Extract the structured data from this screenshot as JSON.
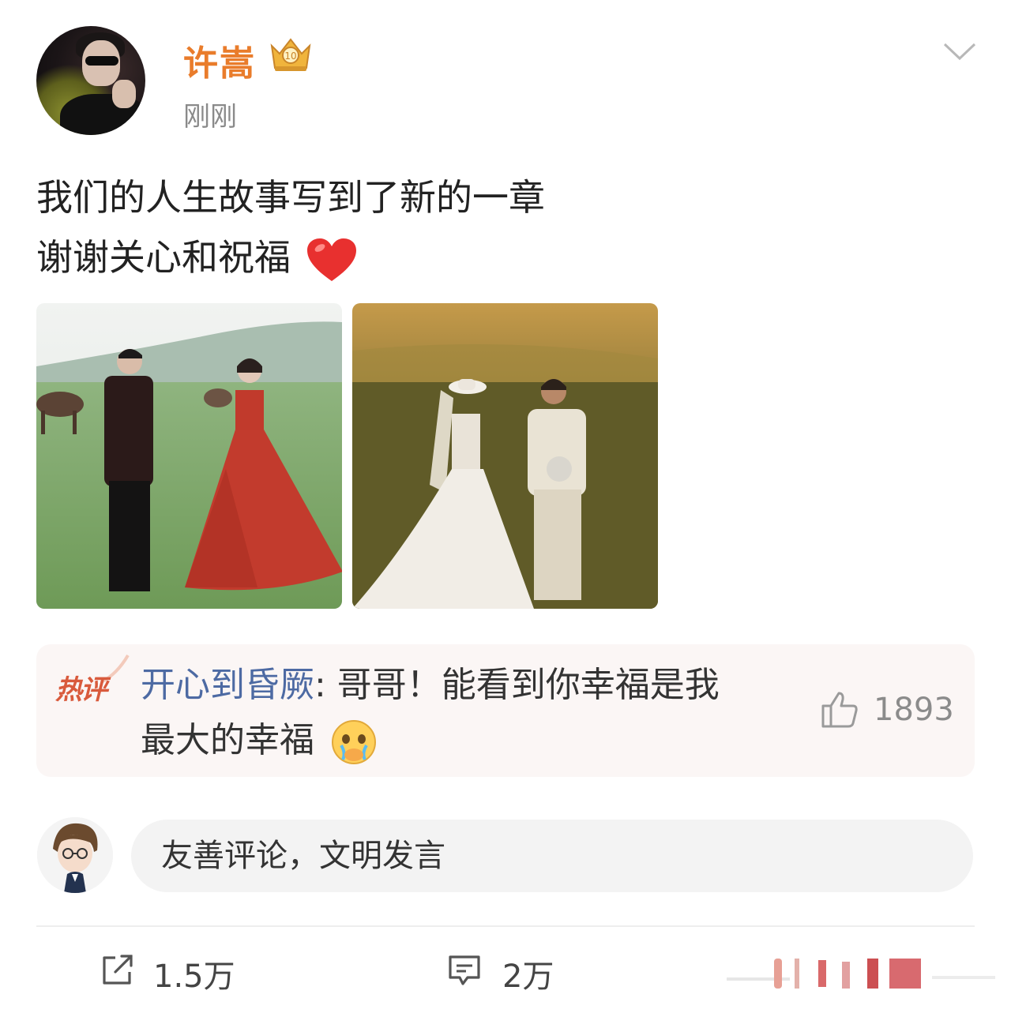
{
  "post": {
    "username": "许嵩",
    "timestamp": "刚刚",
    "text_line1": "我们的人生故事写到了新的一章",
    "text_line2": "谢谢关心和祝福",
    "colors": {
      "username": "#e97c2b",
      "hot_tag": "#d95a3c",
      "hot_user": "#4d6aa3"
    },
    "icons": [
      "verified-badge-icon",
      "chevron-down-icon",
      "heart-emoji-icon"
    ]
  },
  "hot_comment": {
    "tag": "热评",
    "user": "开心到昏厥",
    "text_line1": ": 哥哥！能看到你幸福是我",
    "text_line2": "最大的幸福",
    "likes": "1893"
  },
  "comment_input": {
    "placeholder": "友善评论，文明发言"
  },
  "actions": {
    "share_count": "1.5万",
    "comment_count": "2万"
  }
}
